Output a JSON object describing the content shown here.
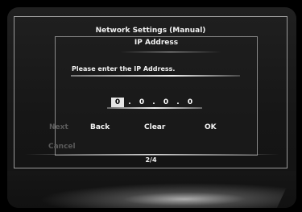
{
  "dialog": {
    "title": "Network Settings (Manual)",
    "subtitle": "IP Address",
    "prompt": "Please enter the IP Address."
  },
  "ip_address": {
    "fields": [
      "0",
      "0",
      "0",
      "0"
    ],
    "separator": ".",
    "active_field_index": 0
  },
  "buttons": {
    "next": "Next",
    "back": "Back",
    "clear": "Clear",
    "ok": "OK",
    "cancel": "Cancel"
  },
  "page_indicator": "2/4"
}
